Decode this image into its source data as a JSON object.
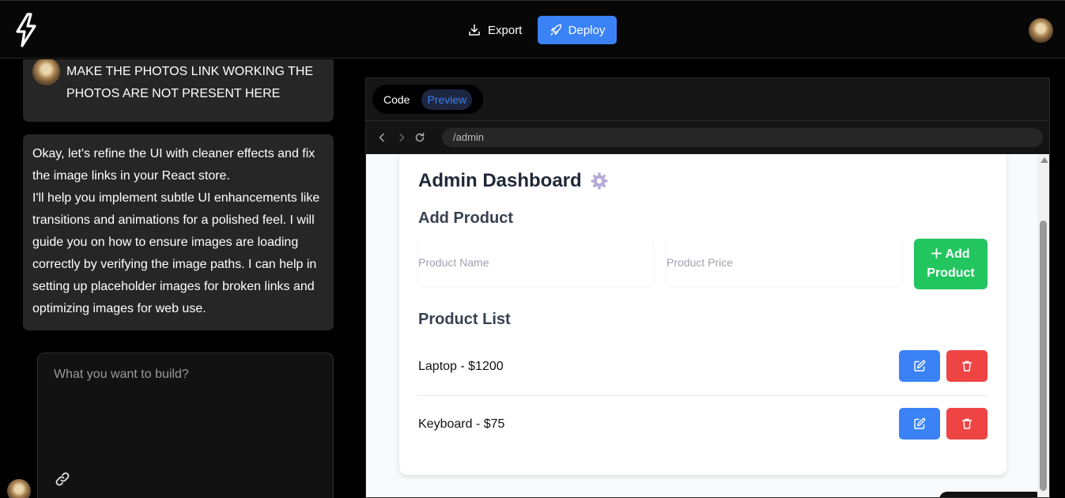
{
  "header": {
    "logo_icon": "lightning-bolt-icon",
    "export_label": "Export",
    "deploy_label": "Deploy",
    "accent": "#3b82f6"
  },
  "chat": {
    "user_message": "MAKE THE PHOTOS LINK WORKING THE PHOTOS ARE NOT PRESENT HERE",
    "assistant_message_1": "Okay, let's refine the UI with cleaner effects and fix the image links in your React store.",
    "assistant_message_2": "I'll help you implement subtle UI enhancements like transitions and animations for a polished feel. I will guide you on how to ensure images are loading correctly by verifying the image paths. I can help in setting up placeholder images for broken links and optimizing images for web use.",
    "prompt_placeholder": "What you want to build?"
  },
  "workspace": {
    "tabs": [
      {
        "label": "Code"
      },
      {
        "label": "Preview",
        "active": true
      }
    ],
    "url": "/admin"
  },
  "preview": {
    "title": "Admin Dashboard",
    "add_section_title": "Add Product",
    "name_placeholder": "Product Name",
    "price_placeholder": "Product Price",
    "add_button_label": "Add Product",
    "list_title": "Product List",
    "products": [
      {
        "label": "Laptop - $1200"
      },
      {
        "label": "Keyboard - $75"
      }
    ],
    "colors": {
      "add": "#22c55e",
      "edit": "#3b82f6",
      "delete": "#ef4444"
    }
  }
}
